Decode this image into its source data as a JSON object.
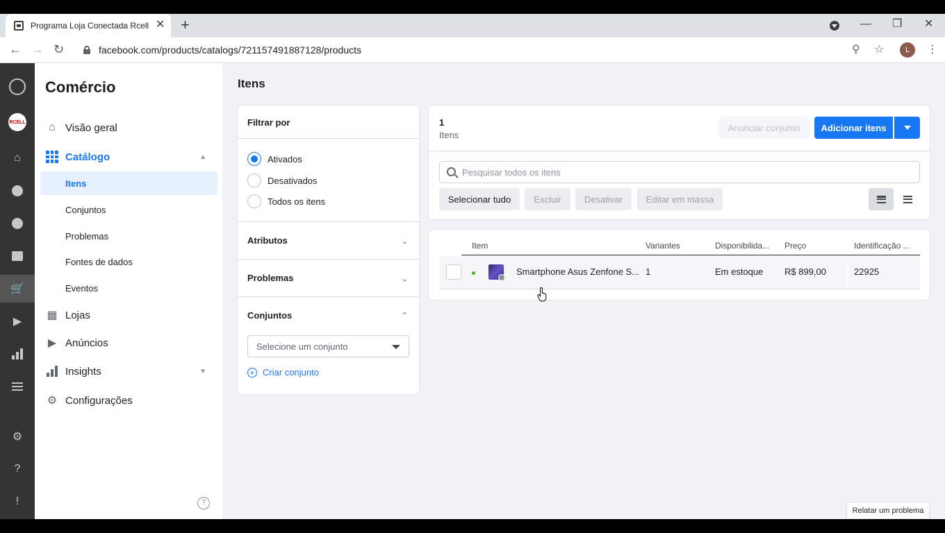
{
  "browser": {
    "tab_title": "Programa Loja Conectada Rcell",
    "tab_close": "✕",
    "new_tab": "+",
    "url": "facebook.com/products/catalogs/721157491887128/products",
    "profile_initial": "L"
  },
  "rail": {
    "avatar_text": "RCELL"
  },
  "sidebar": {
    "title": "Comércio",
    "items": [
      {
        "label": "Visão geral",
        "icon": "home-outline-icon"
      },
      {
        "label": "Catálogo",
        "icon": "grid-icon"
      },
      {
        "label": "Lojas",
        "icon": "store-icon"
      },
      {
        "label": "Anúncios",
        "icon": "megaphone-icon"
      },
      {
        "label": "Insights",
        "icon": "bar-chart-icon"
      },
      {
        "label": "Configurações",
        "icon": "gear-icon"
      }
    ],
    "catalog_sub": [
      {
        "label": "Itens"
      },
      {
        "label": "Conjuntos"
      },
      {
        "label": "Problemas"
      },
      {
        "label": "Fontes de dados"
      },
      {
        "label": "Eventos"
      }
    ],
    "help": "?"
  },
  "page": {
    "title": "Itens"
  },
  "filter": {
    "title": "Filtrar por",
    "options": [
      {
        "label": "Ativados",
        "selected": true
      },
      {
        "label": "Desativados",
        "selected": false
      },
      {
        "label": "Todos os itens",
        "selected": false
      }
    ],
    "sections": {
      "attributes": "Atributos",
      "problems": "Problemas",
      "sets": "Conjuntos"
    },
    "set_select_placeholder": "Selecione um conjunto",
    "create_set": "Criar conjunto"
  },
  "summary": {
    "count": "1",
    "count_label": "Itens",
    "advertise_set": "Anunciar conjunto",
    "add_items": "Adicionar itens",
    "search_placeholder": "Pesquisar todos os itens",
    "select_all": "Selecionar tudo",
    "delete": "Excluir",
    "deactivate": "Desativar",
    "bulk_edit": "Editar em massa"
  },
  "table": {
    "columns": [
      "Item",
      "Variantes",
      "Disponibilida...",
      "Preço",
      "Identificação ..."
    ],
    "rows": [
      {
        "name": "Smartphone Asus Zenfone S...",
        "variants": "1",
        "availability": "Em estoque",
        "price": "R$ 899,00",
        "id": "22925"
      }
    ]
  },
  "footer": {
    "report": "Relatar um problema"
  },
  "colors": {
    "accent": "#1877f2",
    "status_active": "#42b72a"
  }
}
